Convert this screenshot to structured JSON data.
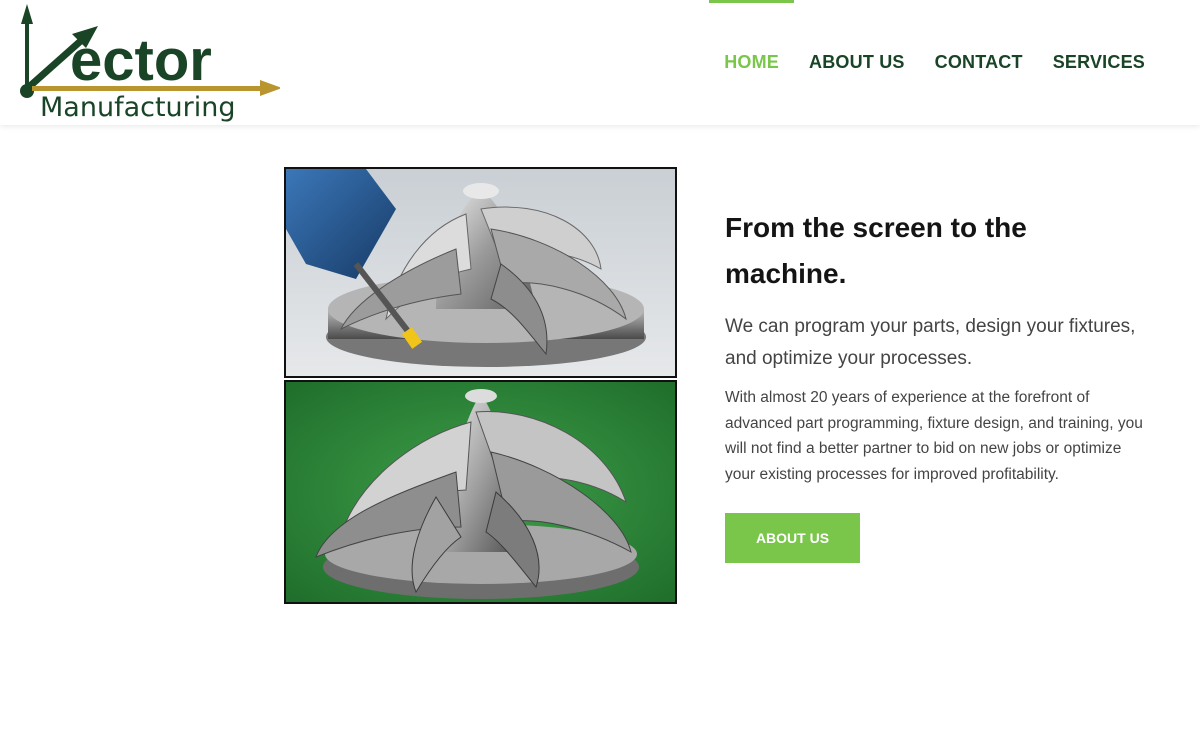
{
  "logo": {
    "wordmark": "ector",
    "subtitle": "Manufacturing",
    "colors": {
      "green": "#1a4426",
      "gold": "#b8952f"
    }
  },
  "nav": {
    "items": [
      {
        "label": "HOME",
        "active": true
      },
      {
        "label": "ABOUT US",
        "active": false
      },
      {
        "label": "CONTACT",
        "active": false
      },
      {
        "label": "SERVICES",
        "active": false
      }
    ]
  },
  "hero": {
    "headline": "From the screen to the machine.",
    "subhead": "We can program your parts, design your fixtures, and optimize your processes.",
    "body": "With almost 20 years of experience at the forefront of advanced part programming, fixture design, and training, you will not find a better partner to bid on new jobs or optimize your existing processes for improved profitability.",
    "cta_label": "ABOUT US"
  },
  "images": {
    "top": "cam-simulation-impeller-image",
    "bottom": "machined-impeller-photo"
  },
  "colors": {
    "accent": "#79c64a",
    "nav_text": "#1a4426",
    "heading": "#141414",
    "body": "#444444"
  }
}
